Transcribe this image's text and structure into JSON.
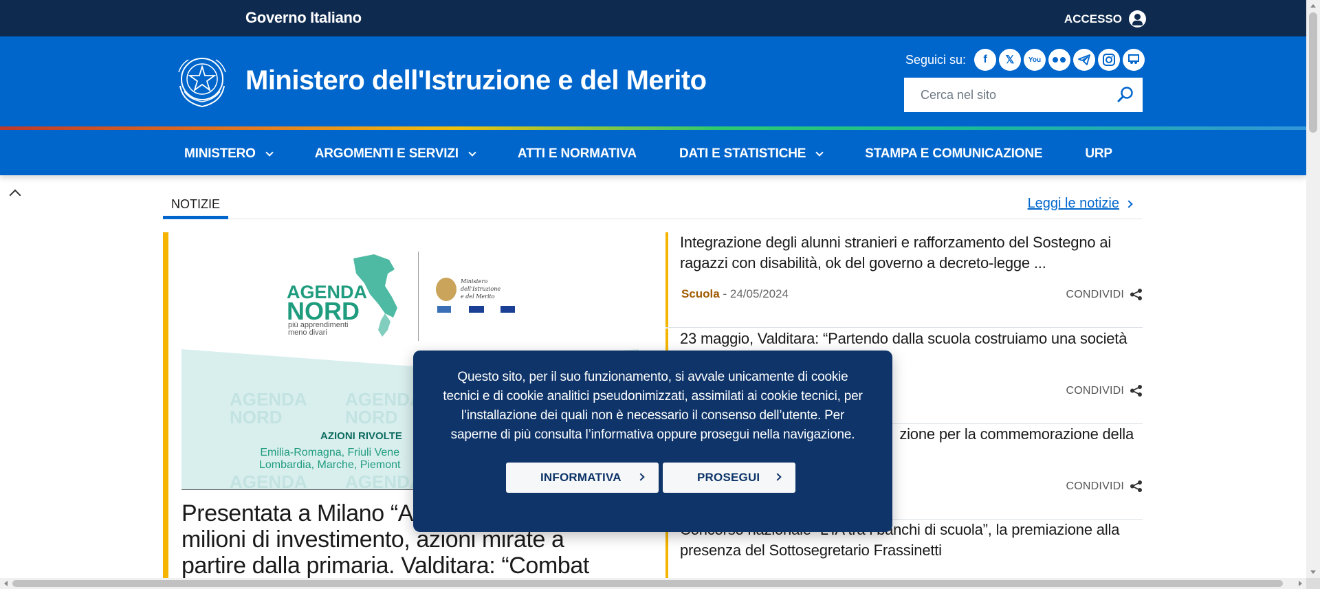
{
  "slim_header": {
    "brand": "Governo Italiano",
    "access_label": "ACCESSO"
  },
  "header": {
    "title": "Ministero dell'Istruzione e del Merito",
    "social_label": "Seguici su:",
    "social_icons": [
      "facebook-icon",
      "x-icon",
      "youtube-icon",
      "flickr-icon",
      "telegram-icon",
      "instagram-icon",
      "slideshare-icon"
    ],
    "search_placeholder": "Cerca nel sito"
  },
  "nav": {
    "items": [
      {
        "label": "MINISTERO",
        "dropdown": true
      },
      {
        "label": "ARGOMENTI E SERVIZI",
        "dropdown": true
      },
      {
        "label": "ATTI E NORMATIVA",
        "dropdown": false
      },
      {
        "label": "DATI E STATISTICHE",
        "dropdown": true
      },
      {
        "label": "STAMPA E COMUNICAZIONE",
        "dropdown": false
      },
      {
        "label": "URP",
        "dropdown": false
      }
    ]
  },
  "news": {
    "tab_label": "NOTIZIE",
    "read_all_label": "Leggi le notizie",
    "featured": {
      "image_text": {
        "agenda": "AGENDA",
        "nord": "NORD",
        "tagline_1": "più apprendimenti",
        "tagline_2": "meno divari",
        "ministry_1": "Ministero dell'Istruzione",
        "ministry_2": "e del Merito",
        "azioni": "AZIONI RIVOLTE",
        "regions_1": "Emilia-Romagna, Friuli Vene",
        "regions_2": "Lombardia, Marche, Piemont"
      },
      "title": "Presentata a Milano “Agenda Nord”: 250 milioni di investimento, azioni mirate a partire dalla primaria. Valditara: “Combat"
    },
    "items": [
      {
        "title": "Integrazione degli alunni stranieri e rafforzamento del Sostegno ai ragazzi con disabilità, ok del governo a decreto-legge ...",
        "category": "Scuola",
        "date": "24/05/2024",
        "share_label": "CONDIVIDI"
      },
      {
        "title": "23 maggio, Valditara: “Partendo dalla scuola costruiamo una società",
        "category": "",
        "date": "",
        "share_label": "CONDIVIDI"
      },
      {
        "title": "zione per la commemorazione della",
        "category": "",
        "date": "",
        "share_label": "CONDIVIDI"
      },
      {
        "title": "Concorso nazionale “L’IA tra i banchi di scuola”, la premiazione alla presenza del Sottosegretario Frassinetti",
        "category": "",
        "date": "",
        "share_label": ""
      }
    ]
  },
  "cookie_banner": {
    "message": "Questo sito, per il suo funzionamento, si avvale unicamente di cookie tecnici e di cookie analitici pseudonimizzati, assimilati ai cookie tecnici, per l’installazione dei quali non è necessario il consenso dell’utente. Per saperne di più consulta l’informativa oppure prosegui nella navigazione.",
    "info_button": "INFORMATIVA",
    "continue_button": "PROSEGUI"
  },
  "colors": {
    "slim_bg": "#0e2a4f",
    "brand_blue": "#0066cc",
    "cookie_bg": "#0e3469",
    "accent_yellow": "#f4b400",
    "category_color": "#a05a00"
  }
}
